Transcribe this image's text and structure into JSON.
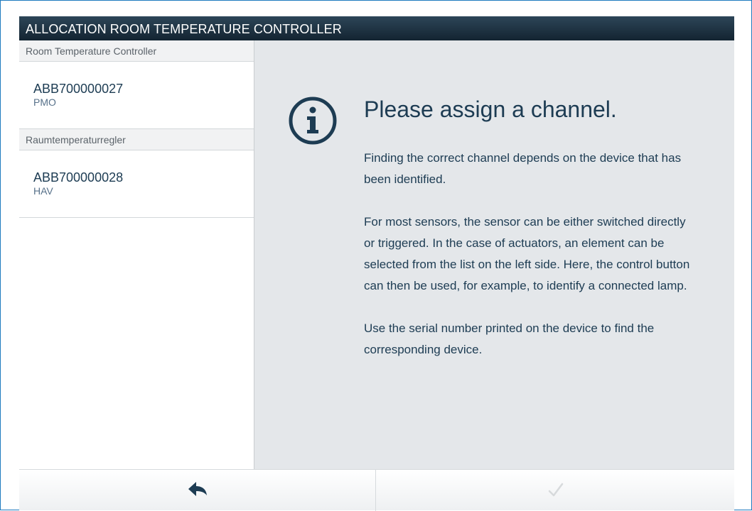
{
  "window": {
    "title": "ALLOCATION ROOM TEMPERATURE CONTROLLER"
  },
  "sidebar": {
    "groups": [
      {
        "header": "Room Temperature Controller",
        "items": [
          {
            "serial": "ABB700000027",
            "sub": "PMO"
          }
        ]
      },
      {
        "header": "Raumtemperaturregler",
        "items": [
          {
            "serial": "ABB700000028",
            "sub": "HAV"
          }
        ]
      }
    ]
  },
  "main": {
    "icon": "info-circle-icon",
    "heading": "Please assign a channel.",
    "paragraphs": [
      "Finding the correct channel depends on the device that has been identified.",
      "For most sensors, the sensor can be either switched directly or triggered. In the case of actuators, an element can be selected from the list on the left side. Here, the control button can then be used, for example, to identify a connected lamp.",
      "Use the serial number printed on the device to find the corresponding device."
    ]
  },
  "footer": {
    "back_icon": "back-arrow-icon",
    "confirm_icon": "checkmark-icon",
    "confirm_enabled": false
  },
  "colors": {
    "title_bar": "#1e3344",
    "accent_text": "#1d3c53",
    "content_background": "#e4e7ea",
    "frame_border": "#1f7bbf"
  }
}
